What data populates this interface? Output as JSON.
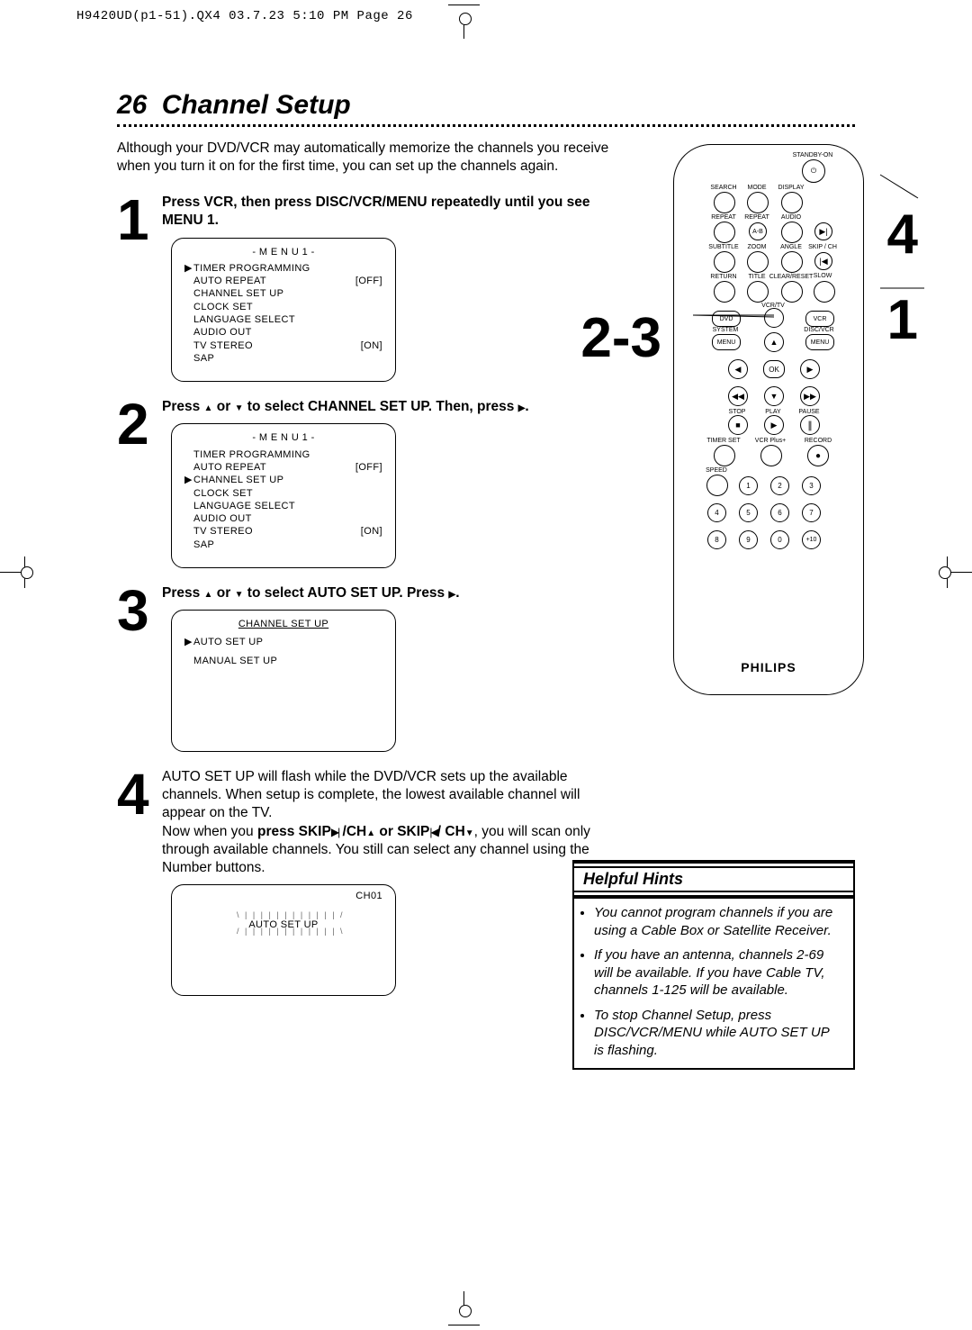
{
  "print_header": "H9420UD(p1-51).QX4  03.7.23  5:10 PM  Page 26",
  "section": {
    "page_number": "26",
    "title": "Channel Setup"
  },
  "intro": "Although your DVD/VCR may automatically memorize the channels you receive when you turn it on for the first time, you can set up the channels again.",
  "steps": {
    "s1": {
      "num": "1",
      "instr_before": "Press VCR, then press DISC/VCR/MENU repeatedly until you see MENU 1.",
      "osd": {
        "title": "- M E N U  1 -",
        "items": [
          {
            "sel": true,
            "label": "TIMER PROGRAMMING",
            "val": ""
          },
          {
            "sel": false,
            "label": "AUTO REPEAT",
            "val": "[OFF]"
          },
          {
            "sel": false,
            "label": "CHANNEL SET UP",
            "val": ""
          },
          {
            "sel": false,
            "label": "CLOCK SET",
            "val": ""
          },
          {
            "sel": false,
            "label": "LANGUAGE SELECT",
            "val": ""
          },
          {
            "sel": false,
            "label": "AUDIO OUT",
            "val": ""
          },
          {
            "sel": false,
            "label": "TV STEREO",
            "val": "[ON]"
          },
          {
            "sel": false,
            "label": "SAP",
            "val": ""
          }
        ]
      }
    },
    "s2": {
      "num": "2",
      "instr_a": "Press ",
      "instr_b": " or ",
      "instr_c": " to select CHANNEL SET UP. Then, press ",
      "instr_d": ".",
      "osd": {
        "title": "- M E N U  1 -",
        "items": [
          {
            "sel": false,
            "label": "TIMER PROGRAMMING",
            "val": ""
          },
          {
            "sel": false,
            "label": "AUTO REPEAT",
            "val": "[OFF]"
          },
          {
            "sel": true,
            "label": "CHANNEL SET UP",
            "val": ""
          },
          {
            "sel": false,
            "label": "CLOCK SET",
            "val": ""
          },
          {
            "sel": false,
            "label": "LANGUAGE SELECT",
            "val": ""
          },
          {
            "sel": false,
            "label": "AUDIO OUT",
            "val": ""
          },
          {
            "sel": false,
            "label": "TV STEREO",
            "val": "[ON]"
          },
          {
            "sel": false,
            "label": "SAP",
            "val": ""
          }
        ]
      }
    },
    "s3": {
      "num": "3",
      "instr_a": "Press ",
      "instr_b": " or ",
      "instr_c": " to select AUTO SET UP.  Press ",
      "instr_d": ".",
      "osd": {
        "title": "CHANNEL SET UP",
        "items": [
          {
            "sel": true,
            "label": "AUTO SET UP"
          },
          {
            "sel": false,
            "label": "MANUAL SET UP"
          }
        ]
      }
    },
    "s4": {
      "num": "4",
      "text1": "AUTO SET UP will flash while the DVD/VCR sets up the available channels. When setup is complete, the lowest available channel will appear on the TV.",
      "text2a": "Now when you ",
      "text2b": "press SKIP",
      "text2c": " /CH",
      "text2d": " or SKIP",
      "text2e": "/ CH",
      "text2f": ",",
      "text3": "you will scan only through available channels. You still can select any channel using the Number buttons.",
      "osd": {
        "ch": "CH01",
        "label": "AUTO SET UP"
      }
    }
  },
  "remote": {
    "brand": "PHILIPS",
    "callouts": {
      "c1": "1",
      "c23": "2-3",
      "c4": "4"
    },
    "labels": {
      "standby": "STANDBY-ON",
      "search": "SEARCH",
      "mode": "MODE",
      "display": "DISPLAY",
      "repeat": "REPEAT",
      "repeatAB": "REPEAT",
      "ab": "A-B",
      "audio": "AUDIO",
      "subtitle": "SUBTITLE",
      "zoom": "ZOOM",
      "angle": "ANGLE",
      "skipch": "SKIP / CH",
      "slow": "SLOW",
      "return": "RETURN",
      "title": "TITLE",
      "clearreset": "CLEAR/RESET",
      "vcrtv": "VCR/TV",
      "dvd": "DVD",
      "vcr": "VCR",
      "system": "SYSTEM",
      "menu": "MENU",
      "discvcr": "DISC/VCR",
      "ok": "OK",
      "stop": "STOP",
      "play": "PLAY",
      "pause": "PAUSE",
      "timerset": "TIMER SET",
      "vcrplus": "VCR Plus+",
      "record": "RECORD",
      "speed": "SPEED",
      "n1": "1",
      "n2": "2",
      "n3": "3",
      "n4": "4",
      "n5": "5",
      "n6": "6",
      "n7": "7",
      "n8": "8",
      "n9": "9",
      "n0": "0",
      "n10": "+10"
    }
  },
  "hints": {
    "title": "Helpful Hints",
    "items": [
      "You cannot program channels if you are using a Cable Box or Satellite Receiver.",
      "If you have an antenna, channels 2-69 will be available.  If you have Cable TV, channels 1-125 will be available.",
      "To stop Channel Setup, press DISC/VCR/MENU while AUTO SET UP is flashing."
    ]
  }
}
